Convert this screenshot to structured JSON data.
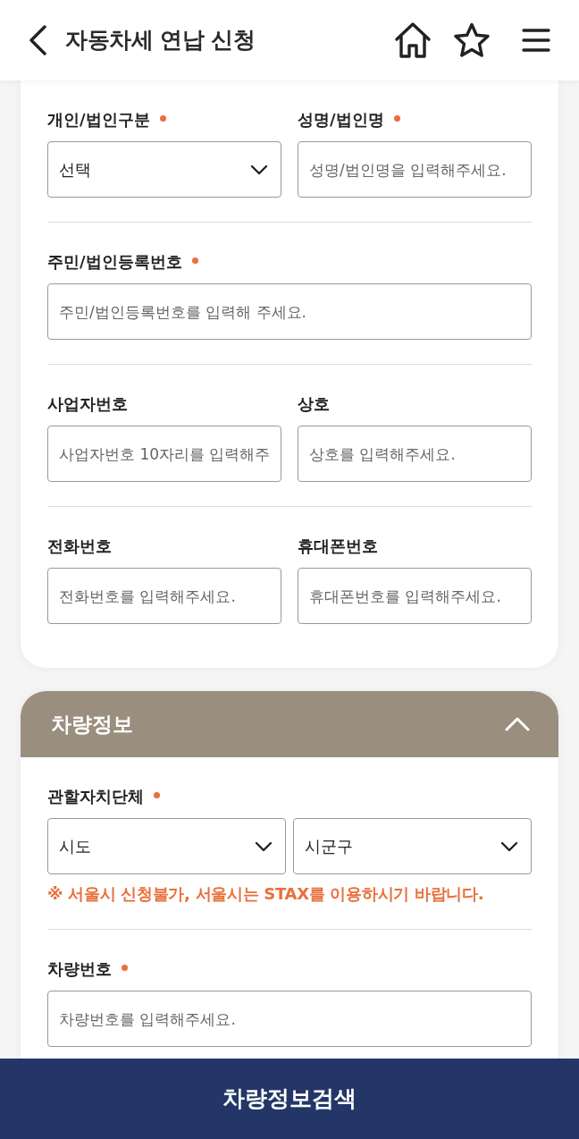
{
  "top_bar": {
    "title": "자동차세 연납 신청"
  },
  "applicant": {
    "rows": [
      {
        "fields": [
          {
            "label": "개인/법인구분",
            "required": true,
            "controls": [
              {
                "kind": "select",
                "value": "선택"
              }
            ]
          },
          {
            "label": "성명/법인명",
            "required": true,
            "controls": [
              {
                "kind": "input",
                "placeholder": "성명/법인명을 입력해주세요."
              }
            ]
          }
        ]
      },
      {
        "fields": [
          {
            "label": "주민/법인등록번호",
            "required": true,
            "controls": [
              {
                "kind": "input",
                "placeholder": "주민/법인등록번호를 입력해 주세요."
              }
            ]
          }
        ]
      },
      {
        "fields": [
          {
            "label": "사업자번호",
            "required": false,
            "controls": [
              {
                "kind": "input",
                "placeholder": "사업자번호 10자리를 입력해주"
              }
            ]
          },
          {
            "label": "상호",
            "required": false,
            "controls": [
              {
                "kind": "input",
                "placeholder": "상호를 입력해주세요."
              }
            ]
          }
        ]
      },
      {
        "fields": [
          {
            "label": "전화번호",
            "required": false,
            "controls": [
              {
                "kind": "input",
                "placeholder": "전화번호를 입력해주세요."
              }
            ]
          },
          {
            "label": "휴대폰번호",
            "required": false,
            "controls": [
              {
                "kind": "input",
                "placeholder": "휴대폰번호를 입력해주세요."
              }
            ]
          }
        ]
      }
    ]
  },
  "vehicle": {
    "title": "차량정보",
    "expanded": true,
    "rows": [
      {
        "fields": [
          {
            "label": "관할자치단체",
            "required": true,
            "controls": [
              {
                "kind": "select",
                "value": "시도"
              },
              {
                "kind": "select",
                "value": "시군구"
              }
            ],
            "note": "※ 서울시 신청불가, 서울시는 STAX를 이용하시기 바랍니다."
          }
        ]
      },
      {
        "fields": [
          {
            "label": "차량번호",
            "required": true,
            "controls": [
              {
                "kind": "input",
                "placeholder": "차량번호를 입력해주세요."
              }
            ]
          }
        ]
      }
    ]
  },
  "search_button": {
    "label": "차량정보검색"
  }
}
